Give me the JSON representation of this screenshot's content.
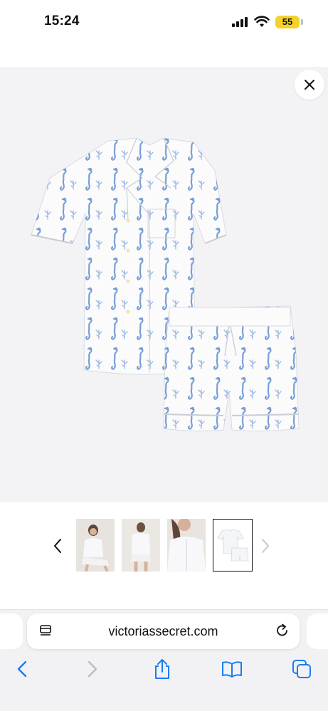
{
  "status_bar": {
    "time": "15:24",
    "battery_level": "55",
    "signal_icon": "cellular-signal-icon",
    "wifi_icon": "wifi-icon"
  },
  "product_viewer": {
    "close_icon": "close-icon",
    "image_icon": "seahorse-pajama-set-image",
    "thumbnails": [
      {
        "name": "model-sitting-thumbnail",
        "selected": false
      },
      {
        "name": "model-back-view-thumbnail",
        "selected": false
      },
      {
        "name": "model-closeup-thumbnail",
        "selected": false
      },
      {
        "name": "product-flatlay-thumbnail",
        "selected": true
      }
    ],
    "prev_icon": "chevron-left-icon",
    "next_icon": "chevron-right-icon"
  },
  "browser": {
    "url": "victoriassecret.com",
    "page_menu_icon": "page-menu-icon",
    "reload_icon": "reload-icon",
    "toolbar": [
      "back-icon",
      "forward-icon",
      "share-icon",
      "bookmarks-icon",
      "tabs-icon"
    ]
  },
  "colors": {
    "accent_blue": "#1a7cf5",
    "print_blue": "#7a9fd4",
    "battery_yellow": "#f3d22c"
  }
}
